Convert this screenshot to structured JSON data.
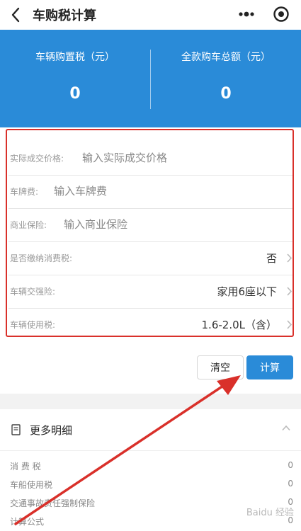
{
  "header": {
    "title": "车购税计算",
    "back_icon": "chevron-left-icon",
    "more_icon": "more-dots-icon",
    "target_icon": "target-icon"
  },
  "summary": {
    "purchase_tax_label": "车辆购置税（元）",
    "purchase_tax_value": "0",
    "total_label": "全款购车总额（元）",
    "total_value": "0",
    "background_color": "#2a8bd8"
  },
  "form": {
    "price": {
      "label": "实际成交价格:",
      "placeholder": "输入实际成交价格",
      "value": ""
    },
    "plate_fee": {
      "label": "车牌费:",
      "placeholder": "输入车牌费",
      "value": ""
    },
    "insurance": {
      "label": "商业保险:",
      "placeholder": "输入商业保险",
      "value": ""
    },
    "consumption_tax": {
      "label": "是否缴纳消费税:",
      "value": "否"
    },
    "compulsory_insurance": {
      "label": "车辆交强险:",
      "value": "家用6座以下"
    },
    "usage_tax": {
      "label": "车辆使用税:",
      "value": "1.6-2.0L（含）"
    },
    "highlight_color": "#d9302a"
  },
  "buttons": {
    "clear_label": "清空",
    "calculate_label": "计算",
    "calculate_color": "#2a8bd8"
  },
  "details": {
    "title": "更多明细",
    "doc_icon": "document-icon",
    "collapse_icon": "chevron-up-icon",
    "rows": [
      {
        "label": "消 费 税",
        "value": "0"
      },
      {
        "label": "车船使用税",
        "value": "0"
      },
      {
        "label": "交通事故责任强制保险",
        "value": "0"
      },
      {
        "label": "计算公式",
        "value": "0"
      }
    ]
  },
  "watermark": "Baidu 经验"
}
